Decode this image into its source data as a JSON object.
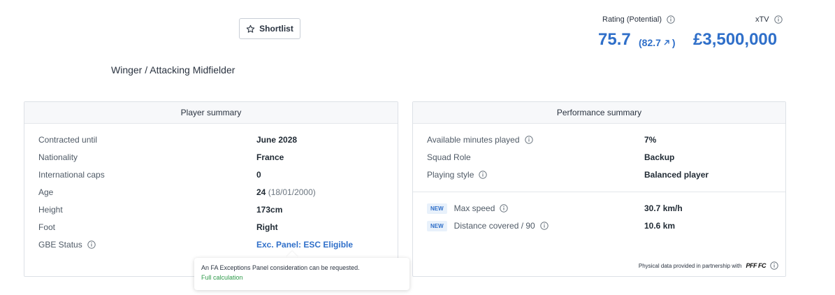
{
  "header": {
    "shortlist_label": "Shortlist",
    "position": "Winger / Attacking Midfielder",
    "rating_label": "Rating (Potential)",
    "rating_value": "75.7",
    "potential_value": "(82.7",
    "potential_suffix": ")",
    "xtv_label": "xTV",
    "xtv_value": "£3,500,000"
  },
  "player_summary": {
    "title": "Player summary",
    "rows": [
      {
        "label": "Contracted until",
        "value": "June 2028"
      },
      {
        "label": "Nationality",
        "value": "France"
      },
      {
        "label": "International caps",
        "value": "0"
      },
      {
        "label": "Age",
        "value": "24",
        "extra": "(18/01/2000)"
      },
      {
        "label": "Height",
        "value": "173cm"
      },
      {
        "label": "Foot",
        "value": "Right"
      },
      {
        "label": "GBE Status",
        "value": "Exc. Panel: ESC Eligible"
      }
    ]
  },
  "performance_summary": {
    "title": "Performance summary",
    "rows": [
      {
        "label": "Available minutes played",
        "value": "7%"
      },
      {
        "label": "Squad Role",
        "value": "Backup"
      },
      {
        "label": "Playing style",
        "value": "Balanced player"
      }
    ],
    "physical_rows": [
      {
        "badge": "NEW",
        "label": "Max speed",
        "value": "30.7 km/h"
      },
      {
        "badge": "NEW",
        "label": "Distance covered / 90",
        "value": "10.6 km"
      }
    ],
    "footer_note": "Physical data provided in partnership with",
    "partner_logo": "PFF FC"
  },
  "tooltip": {
    "text": "An FA Exceptions Panel consideration can be requested.",
    "link": "Full calculation"
  },
  "colors": {
    "accent": "#2f6fc9",
    "link_green": "#2e9a4a"
  }
}
